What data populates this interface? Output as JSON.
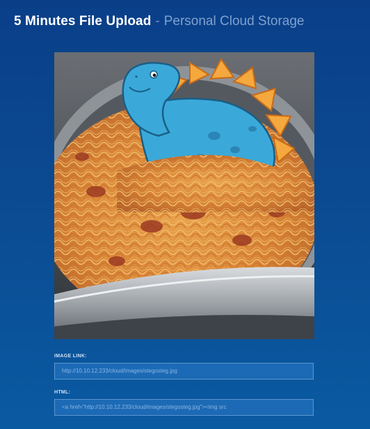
{
  "header": {
    "brand": "5 Minutes File Upload",
    "separator": "-",
    "subtitle": "Personal Cloud Storage"
  },
  "image": {
    "description_icon": "image-icon"
  },
  "fields": {
    "image_link_label": "IMAGE LINK:",
    "image_link_value": "http://10.10.12.233/cloud/images/stegosteg.jpg",
    "html_label": "HTML:",
    "html_value": "<a href=\"http://10.10.12.233/cloud/images/stegosteg.jpg\"><img src"
  },
  "colors": {
    "background_top": "#0a3f88",
    "background_bottom": "#0a5aa2",
    "field_bg": "#1c6ab5",
    "field_border": "#5c95d0",
    "field_text": "#8bb5e3"
  }
}
